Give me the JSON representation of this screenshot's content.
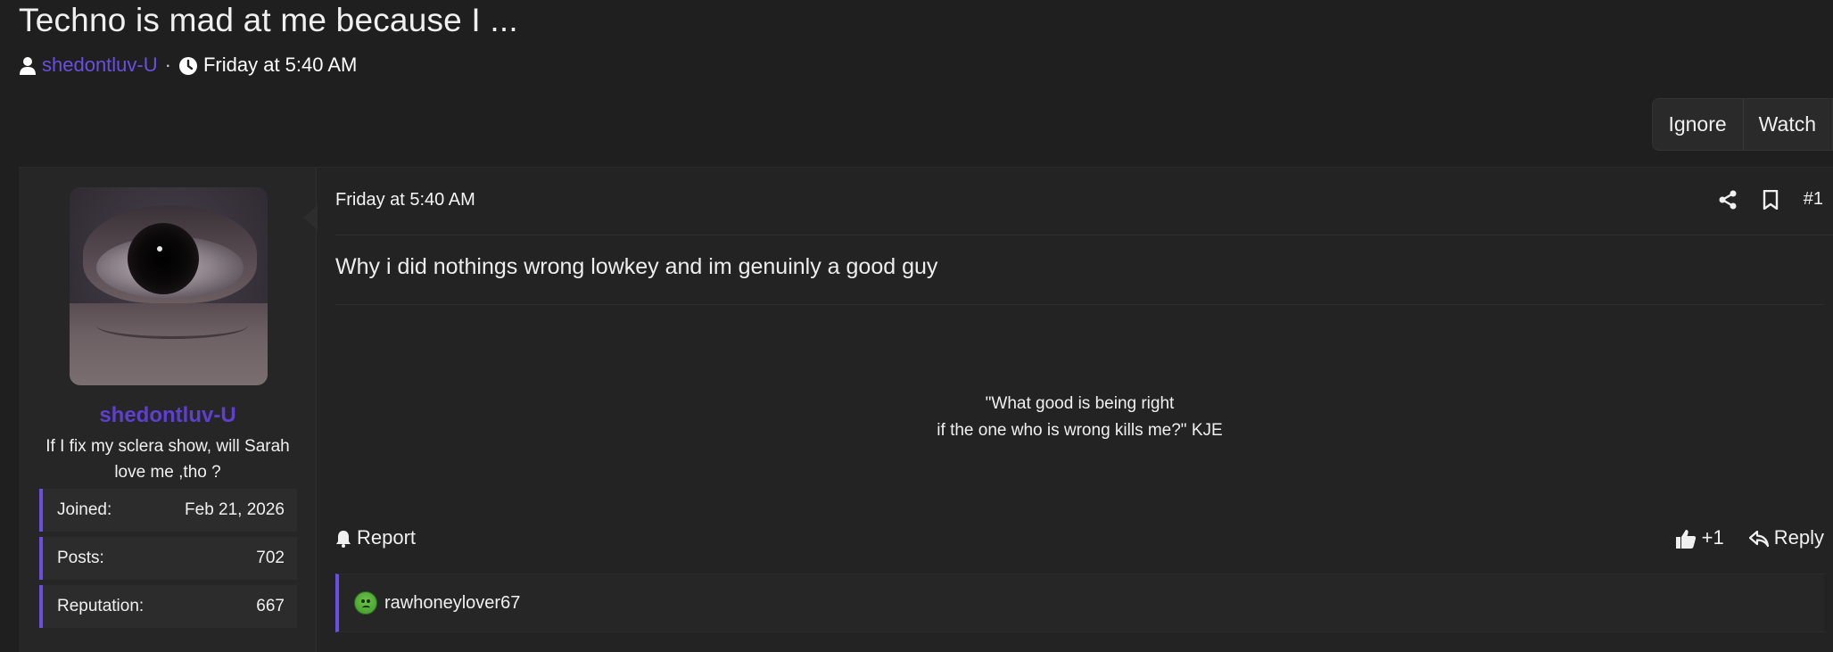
{
  "thread": {
    "title": "Techno is mad at me because I ...",
    "author": "shedontluv-U",
    "separator": "·",
    "date": "Friday at 5:40 AM"
  },
  "actions": {
    "ignore": "Ignore",
    "watch": "Watch"
  },
  "user": {
    "name": "shedontluv-U",
    "title": "If I fix my sclera show, will Sarah love me ,tho ?",
    "stats": [
      {
        "label": "Joined:",
        "value": "Feb 21, 2026"
      },
      {
        "label": "Posts:",
        "value": "702"
      },
      {
        "label": "Reputation:",
        "value": "667"
      }
    ]
  },
  "post": {
    "date": "Friday at 5:40 AM",
    "number": "#1",
    "body": "Why i did nothings wrong lowkey and im genuinly a good guy",
    "signature_line1": "\"What good is being right",
    "signature_line2": "if the one who is wrong kills me?\" KJE",
    "report": "Report",
    "like_count": "+1",
    "reply": "Reply"
  },
  "reactions": {
    "users": "rawhoneylover67"
  },
  "icons": {
    "author": "user-icon",
    "date": "clock-icon",
    "share": "share-icon",
    "bookmark": "bookmark-icon",
    "report": "bell-icon",
    "like": "thumbs-up-icon",
    "reply": "reply-icon",
    "reaction": "sick-face-icon"
  },
  "colors": {
    "accent": "#6a4fe0",
    "background": "#1f1f1f"
  }
}
